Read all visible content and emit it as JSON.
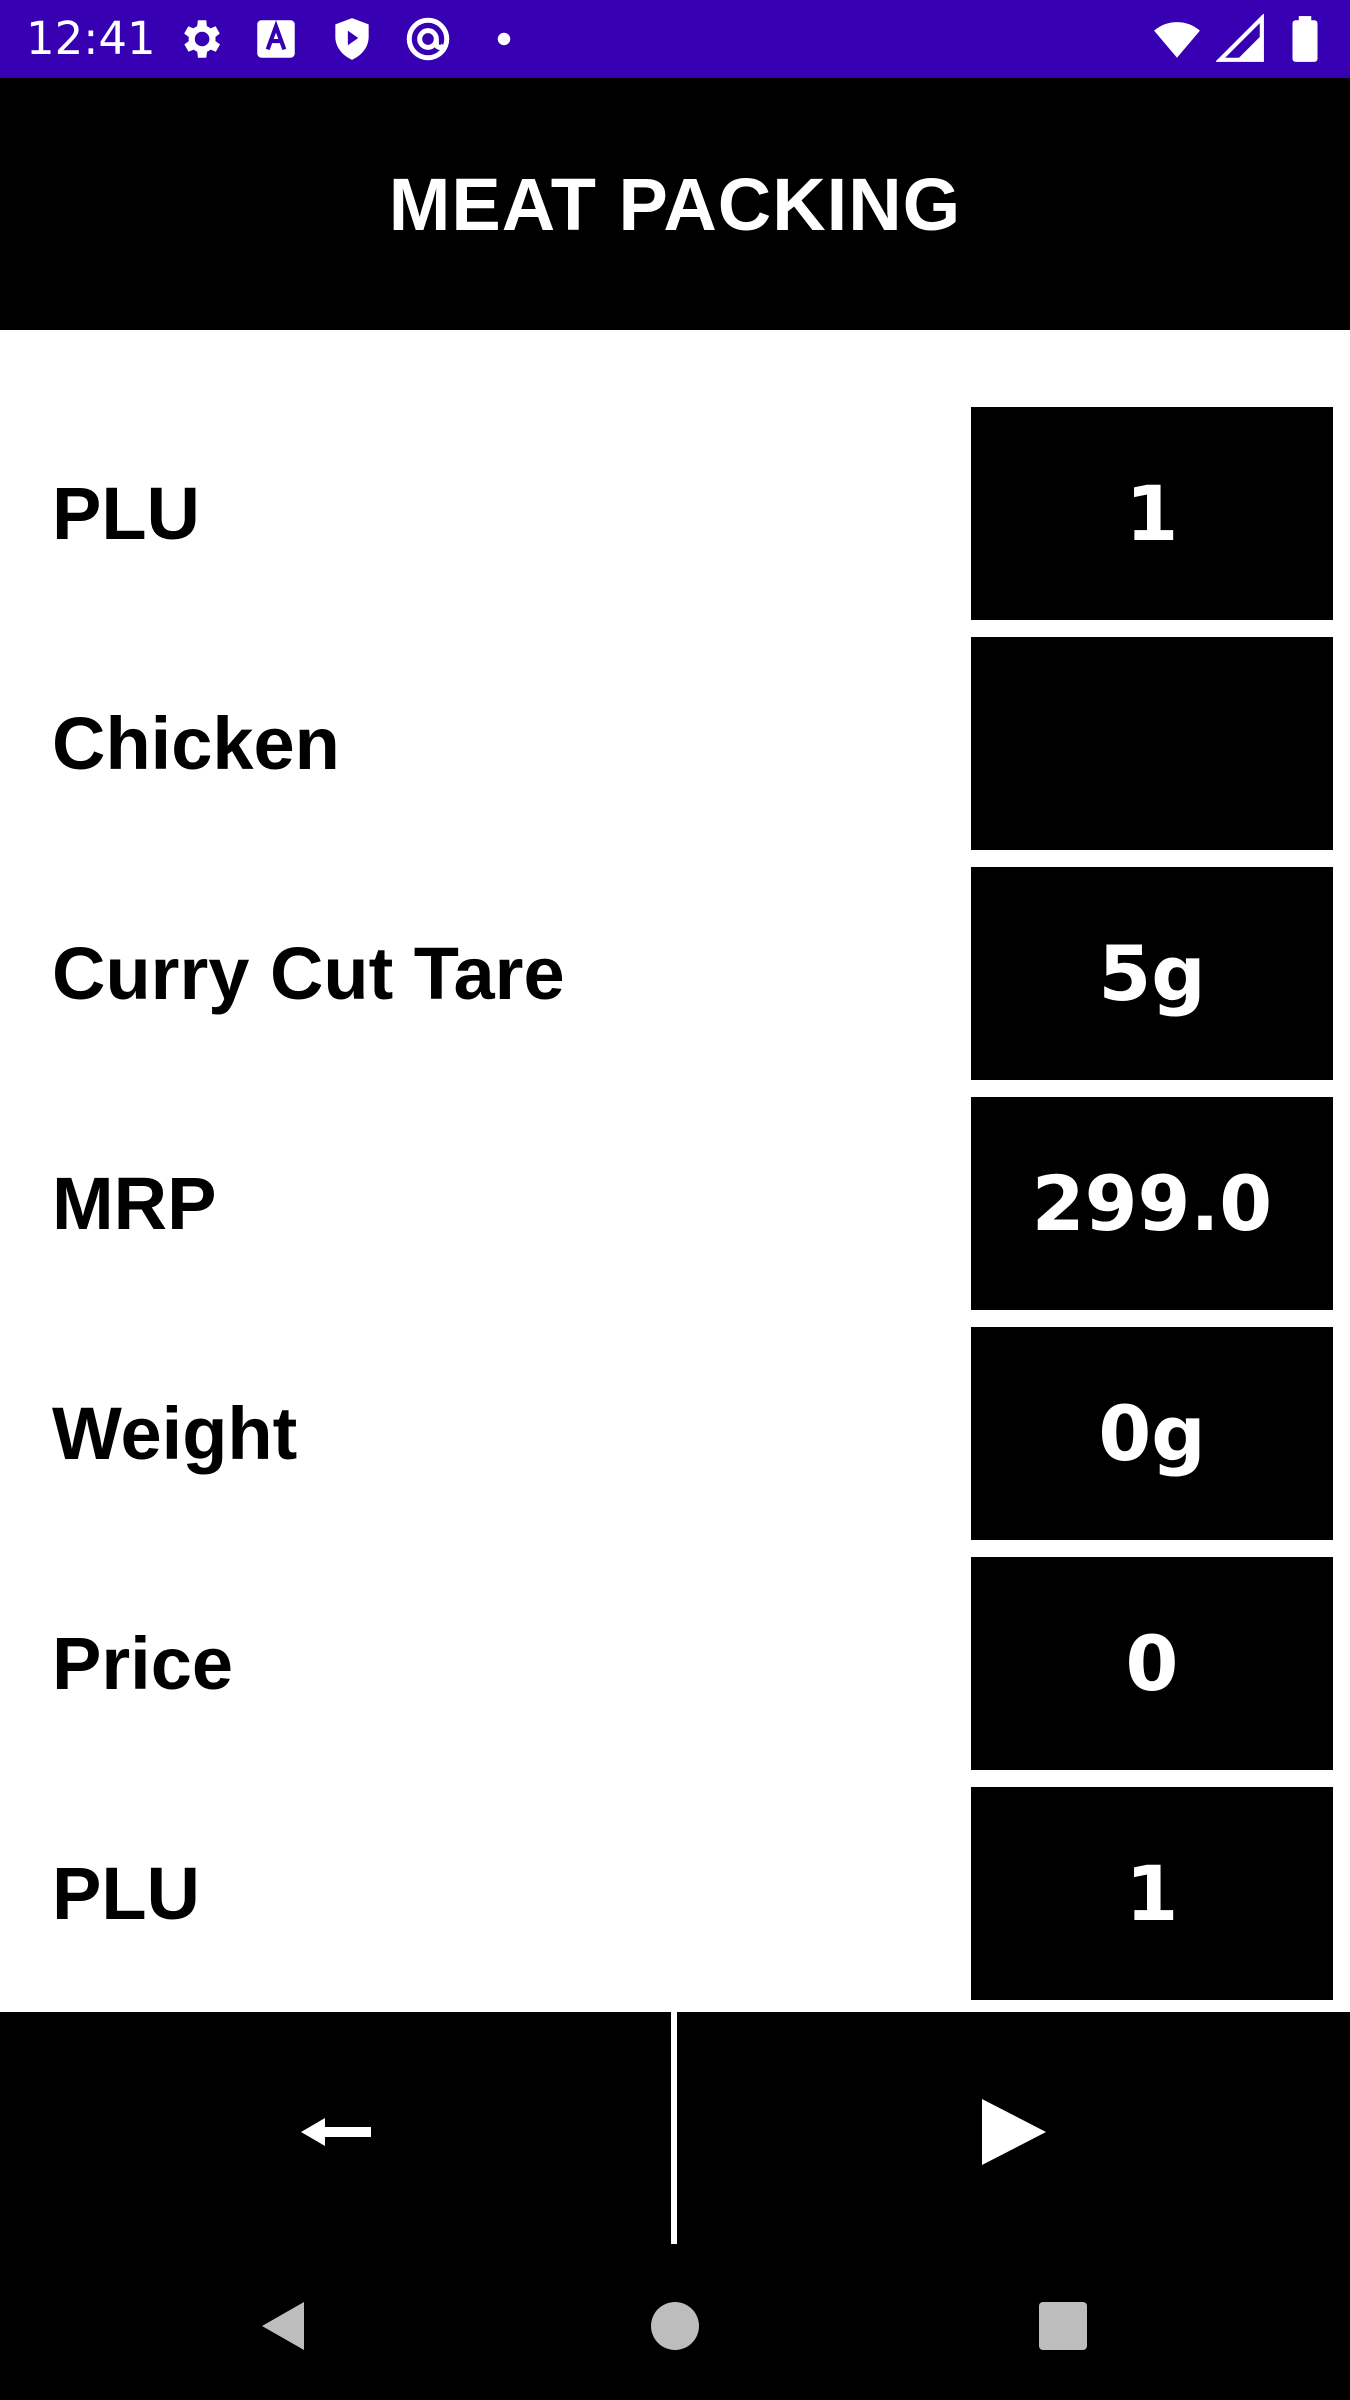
{
  "status_bar": {
    "time": "12:41",
    "left_icons": [
      "gear-icon",
      "text-input-icon",
      "shield-play-icon",
      "at-sync-icon",
      "dot-icon"
    ],
    "right_icons": [
      "wifi-icon",
      "cell-signal-icon",
      "battery-icon"
    ],
    "color": "#3700b3"
  },
  "app_bar": {
    "title": "MEAT PACKING"
  },
  "rows": [
    {
      "label": "PLU",
      "value": "1"
    },
    {
      "label": "Chicken",
      "value": ""
    },
    {
      "label": "Curry Cut Tare",
      "value": "5g"
    },
    {
      "label": "MRP",
      "value": "299.0"
    },
    {
      "label": "Weight",
      "value": "0g"
    },
    {
      "label": "Price",
      "value": "0"
    },
    {
      "label": "PLU",
      "value": "1"
    }
  ],
  "bottom_bar": {
    "back_icon": "left-arrow-icon",
    "play_icon": "play-icon"
  },
  "nav_bar": {
    "icons": [
      "back-triangle-icon",
      "home-circle-icon",
      "recents-square-icon"
    ]
  }
}
